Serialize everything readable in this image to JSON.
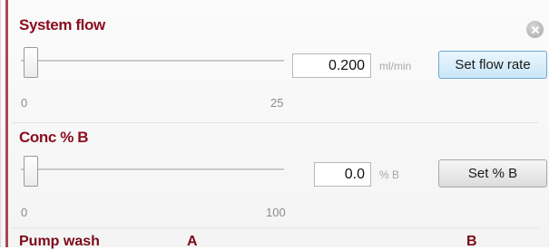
{
  "system_flow": {
    "title": "System flow",
    "slider_min": "0",
    "slider_max": "25",
    "value": "0.200",
    "unit": "ml/min",
    "button": "Set flow rate"
  },
  "conc": {
    "title": "Conc % B",
    "slider_min": "0",
    "slider_max": "100",
    "value": "0.0",
    "unit": "% B",
    "button": "Set % B"
  },
  "pump_wash": {
    "title": "Pump wash",
    "col_a": "A",
    "col_b": "B"
  },
  "icons": {
    "close": "close-icon"
  },
  "colors": {
    "title": "#8b0d1e",
    "primary_button": "#c9e6f8"
  }
}
